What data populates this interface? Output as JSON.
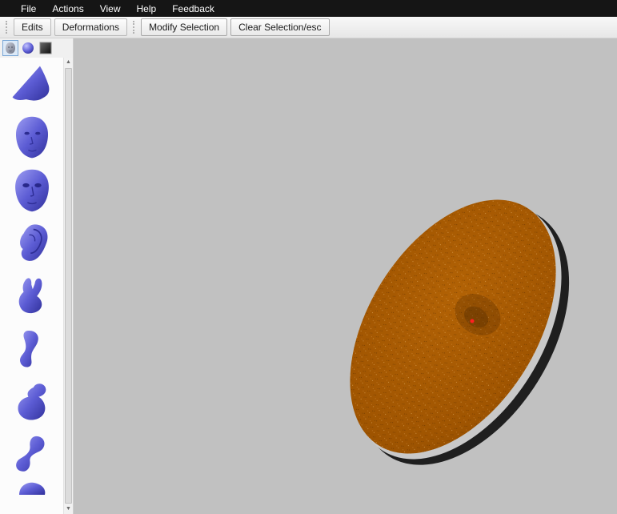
{
  "menubar": {
    "items": [
      {
        "label": "File"
      },
      {
        "label": "Actions"
      },
      {
        "label": "View"
      },
      {
        "label": "Help"
      },
      {
        "label": "Feedback"
      }
    ]
  },
  "toolbar": {
    "buttons": [
      {
        "label": "Edits"
      },
      {
        "label": "Deformations"
      },
      {
        "label": "Modify Selection"
      },
      {
        "label": "Clear Selection/esc"
      }
    ]
  },
  "sidebar": {
    "tabs": [
      {
        "icon": "head-models-tab-icon",
        "selected": true
      },
      {
        "icon": "sphere-models-tab-icon",
        "selected": false
      },
      {
        "icon": "texture-models-tab-icon",
        "selected": false
      }
    ],
    "model_thumbnails": [
      {
        "icon": "wedge-model-icon"
      },
      {
        "icon": "head-model-icon"
      },
      {
        "icon": "face-model-icon"
      },
      {
        "icon": "ear-model-icon"
      },
      {
        "icon": "hand-model-icon"
      },
      {
        "icon": "tube-model-icon"
      },
      {
        "icon": "blob-model-icon"
      },
      {
        "icon": "twist-model-icon"
      },
      {
        "icon": "partial-model-icon"
      }
    ],
    "model_color": "#5c5cd4"
  },
  "viewport": {
    "background": "#c1c1c1",
    "mesh": {
      "name": "orange-disc-mesh",
      "top_color": "#a85a00",
      "side_color": "#1f1f1f",
      "rim_color": "#c9c9c9",
      "marker_color": "#ff2020"
    }
  },
  "icons": {
    "scroll_up_glyph": "▲",
    "scroll_down_glyph": "▼"
  },
  "colors": {
    "menubar_bg": "#151515",
    "menubar_fg": "#ffffff",
    "toolbar_bg": "#eeeeee",
    "sidebar_bg": "#fafafa"
  }
}
